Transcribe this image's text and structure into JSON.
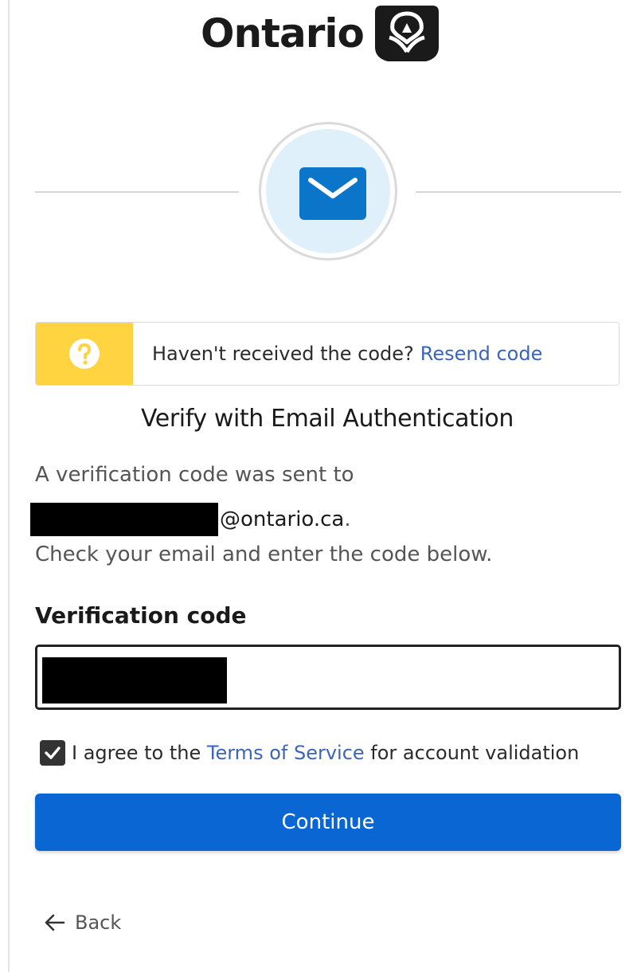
{
  "brand": {
    "name": "Ontario",
    "logo_icon": "trillium-icon"
  },
  "factor": {
    "icon": "mail-icon",
    "accent": "#0a75c9",
    "bg": "#dff0fb"
  },
  "alert": {
    "icon": "help-icon",
    "message": "Haven't received the code?",
    "link_label": "Resend code",
    "strip_color": "#ffd440"
  },
  "main": {
    "title": "Verify with Email Authentication",
    "desc_line1": "A verification code was sent to",
    "email_domain": "@ontario.ca",
    "email_period": ".",
    "desc_line3": "Check your email and enter the code below."
  },
  "form": {
    "code_label": "Verification code",
    "code_value": "",
    "agree": {
      "checked": true,
      "prefix": "I agree to the ",
      "link_label": "Terms of Service",
      "suffix": " for account validation"
    },
    "continue_label": "Continue",
    "continue_color": "#0a66d2"
  },
  "footer": {
    "back_label": "Back",
    "back_icon": "arrow-left-icon"
  }
}
